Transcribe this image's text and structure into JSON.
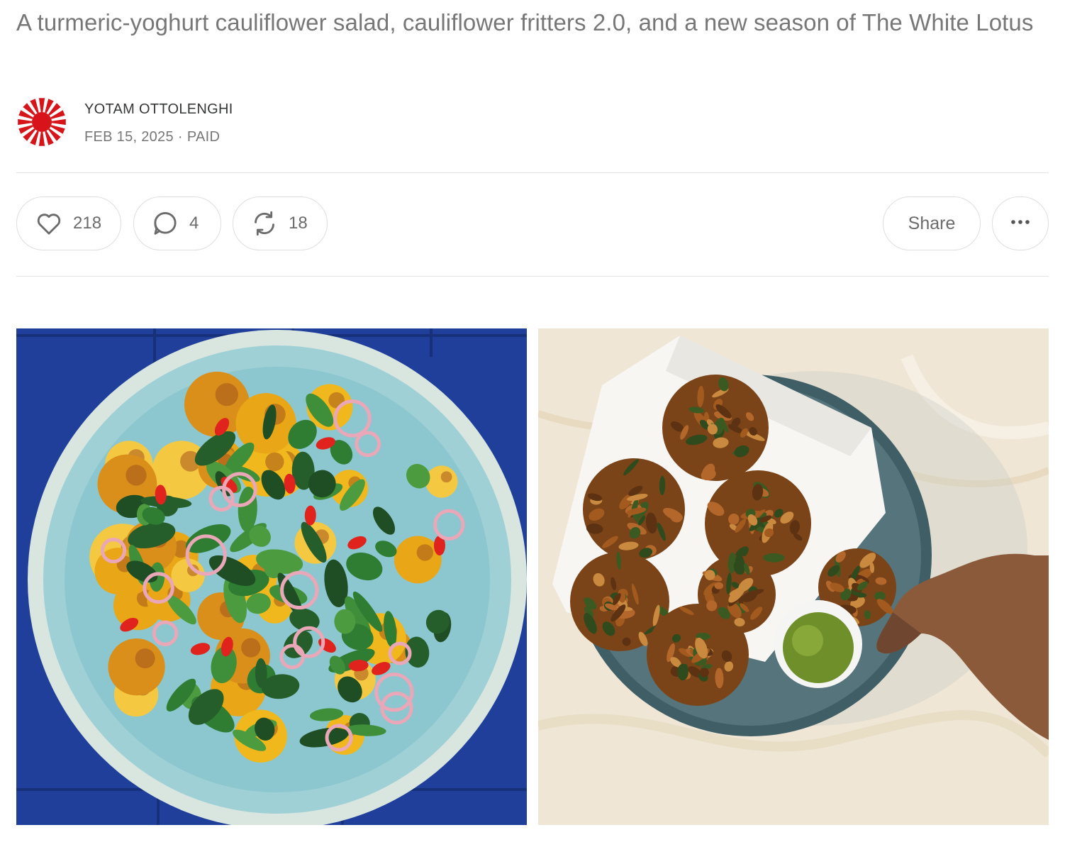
{
  "post": {
    "subtitle": "A turmeric-yoghurt cauliflower salad, cauliflower fritters 2.0, and a new season of The White Lotus"
  },
  "author": {
    "name": "YOTAM OTTOLENGHI",
    "date": "FEB 15, 2025",
    "separator": "·",
    "access": "PAID",
    "avatar_icon": "rising-sun-logo",
    "avatar_color": "#d7141a"
  },
  "actions": {
    "likes": "218",
    "comments": "4",
    "restacks": "18",
    "share_label": "Share",
    "like_icon": "heart-icon",
    "comment_icon": "speech-bubble-icon",
    "restack_icon": "restack-arrows-icon",
    "more_icon": "ellipsis-icon"
  },
  "images": [
    {
      "subject": "cauliflower-salad-photo"
    },
    {
      "subject": "fritters-photo"
    }
  ]
}
